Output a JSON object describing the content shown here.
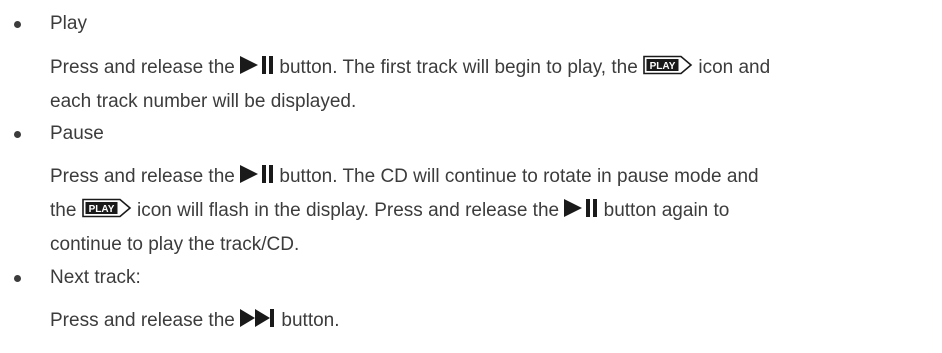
{
  "items": [
    {
      "heading": "Play",
      "lines": [
        {
          "a": "Press and release the",
          "b": "button.  The first track will begin to play, the",
          "c": "icon and"
        },
        {
          "a": "each track number will be displayed."
        }
      ]
    },
    {
      "heading": "Pause",
      "lines": [
        {
          "a": "Press and release the",
          "b": "button. The CD will continue to rotate in pause mode and"
        },
        {
          "a": "the",
          "b": "icon will flash in the display.  Press and release the",
          "c": "button again to"
        },
        {
          "a": "continue to play the track/CD."
        }
      ]
    },
    {
      "heading": "Next track:",
      "lines": [
        {
          "a": "Press and release the",
          "b": "button."
        }
      ]
    }
  ],
  "icons": {
    "play_pause": "play-pause-icon",
    "next_track": "next-track-icon",
    "play_badge": "play-badge-icon",
    "play_badge_text": "PLAY"
  }
}
